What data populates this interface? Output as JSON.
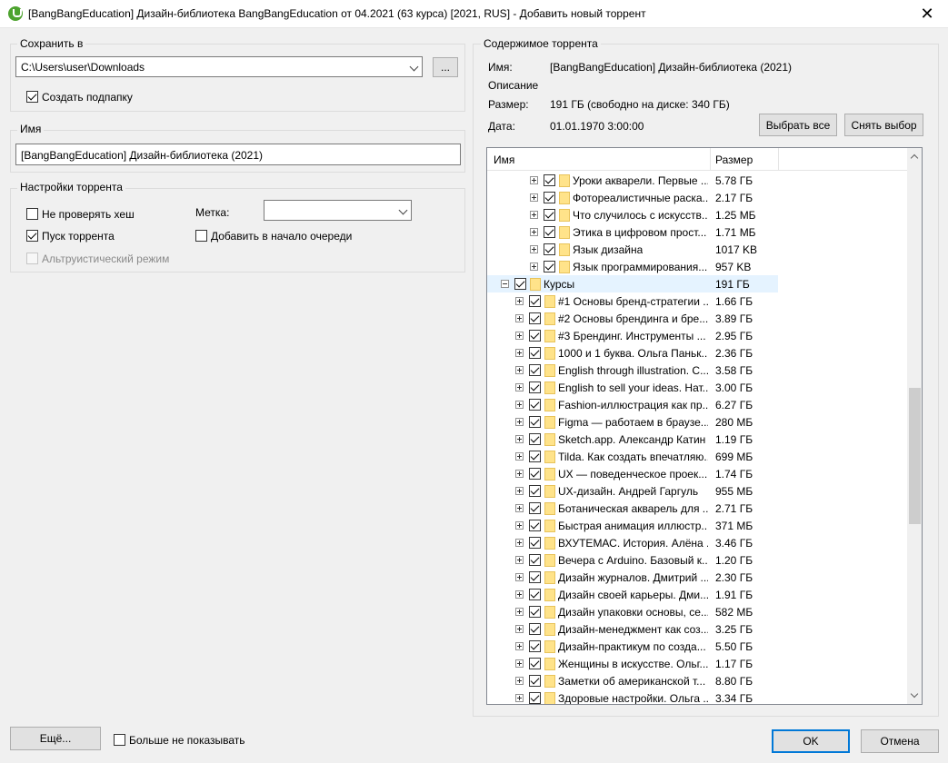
{
  "window": {
    "title": "[BangBangEducation] Дизайн-библиотека BangBangEducation от 04.2021 (63 курса) [2021, RUS] - Добавить новый торрент",
    "close_symbol": "✕"
  },
  "save_to": {
    "group_label": "Сохранить в",
    "path": "C:\\Users\\user\\Downloads",
    "browse_label": "...",
    "create_subfolder_label": "Создать подпапку",
    "create_subfolder_checked": true
  },
  "name_group": {
    "group_label": "Имя",
    "value": "[BangBangEducation] Дизайн-библиотека (2021)"
  },
  "torrent_settings": {
    "group_label": "Настройки торрента",
    "skip_hash_label": "Не проверять хеш",
    "skip_hash_checked": false,
    "start_torrent_label": "Пуск торрента",
    "start_torrent_checked": true,
    "altruistic_label": "Альтруистический режим",
    "altruistic_checked": false,
    "label_label": "Метка:",
    "label_value": "",
    "add_to_top_label": "Добавить в начало очереди",
    "add_to_top_checked": false
  },
  "contents": {
    "group_label": "Содержимое торрента",
    "name_label": "Имя:",
    "name_value": "[BangBangEducation] Дизайн-библиотека (2021)",
    "description_label": "Описание",
    "size_label": "Размер:",
    "size_value": "191 ГБ (свободно на диске: 340 ГБ)",
    "date_label": "Дата:",
    "date_value": "01.01.1970 3:00:00",
    "select_all_label": "Выбрать все",
    "deselect_label": "Снять выбор",
    "col_name": "Имя",
    "col_size": "Размер",
    "rows": [
      {
        "level": 2,
        "name": "Уроки акварели. Первые ...",
        "size": "5.78 ГБ",
        "expanded": false
      },
      {
        "level": 2,
        "name": "Фотореалистичные раска...",
        "size": "2.17 ГБ",
        "expanded": false
      },
      {
        "level": 2,
        "name": "Что случилось с искусств...",
        "size": "1.25 МБ",
        "expanded": false
      },
      {
        "level": 2,
        "name": "Этика в цифровом прост...",
        "size": "1.71 МБ",
        "expanded": false
      },
      {
        "level": 2,
        "name": "Язык дизайна",
        "size": "1017 KB",
        "expanded": false
      },
      {
        "level": 2,
        "name": "Язык программирования....",
        "size": "957 KB",
        "expanded": false
      },
      {
        "level": 0,
        "name": "Курсы",
        "size": "191 ГБ",
        "expanded": true,
        "selected": true
      },
      {
        "level": 1,
        "name": "#1 Основы бренд-стратегии ...",
        "size": "1.66 ГБ",
        "expanded": false
      },
      {
        "level": 1,
        "name": "#2 Основы брендинга и бре...",
        "size": "3.89 ГБ",
        "expanded": false
      },
      {
        "level": 1,
        "name": "#3 Брендинг. Инструменты ...",
        "size": "2.95 ГБ",
        "expanded": false
      },
      {
        "level": 1,
        "name": "1000 и 1 буква. Ольга Паньк...",
        "size": "2.36 ГБ",
        "expanded": false
      },
      {
        "level": 1,
        "name": "English through illustration. C...",
        "size": "3.58 ГБ",
        "expanded": false
      },
      {
        "level": 1,
        "name": "English to sell your ideas. Нат...",
        "size": "3.00 ГБ",
        "expanded": false
      },
      {
        "level": 1,
        "name": "Fashion-иллюстрация как пр...",
        "size": "6.27 ГБ",
        "expanded": false
      },
      {
        "level": 1,
        "name": "Figma — работаем в браузе...",
        "size": "280 МБ",
        "expanded": false
      },
      {
        "level": 1,
        "name": "Sketch.app. Александр Катин",
        "size": "1.19 ГБ",
        "expanded": false
      },
      {
        "level": 1,
        "name": "Tilda. Как создать впечатляю...",
        "size": "699 МБ",
        "expanded": false
      },
      {
        "level": 1,
        "name": "UX — поведенческое проек...",
        "size": "1.74 ГБ",
        "expanded": false
      },
      {
        "level": 1,
        "name": "UX-дизайн. Андрей Гаргуль",
        "size": "955 МБ",
        "expanded": false
      },
      {
        "level": 1,
        "name": "Ботаническая акварель для ...",
        "size": "2.71 ГБ",
        "expanded": false
      },
      {
        "level": 1,
        "name": "Быстрая анимация иллюстр...",
        "size": "371 МБ",
        "expanded": false
      },
      {
        "level": 1,
        "name": "ВХУТЕМАС. История. Алёна ...",
        "size": "3.46 ГБ",
        "expanded": false
      },
      {
        "level": 1,
        "name": "Вечера с Arduino. Базовый к...",
        "size": "1.20 ГБ",
        "expanded": false
      },
      {
        "level": 1,
        "name": "Дизайн журналов. Дмитрий ...",
        "size": "2.30 ГБ",
        "expanded": false
      },
      {
        "level": 1,
        "name": "Дизайн своей карьеры. Дми...",
        "size": "1.91 ГБ",
        "expanded": false
      },
      {
        "level": 1,
        "name": "Дизайн упаковки основы, се...",
        "size": "582 МБ",
        "expanded": false
      },
      {
        "level": 1,
        "name": "Дизайн-менеджмент как соз...",
        "size": "3.25 ГБ",
        "expanded": false
      },
      {
        "level": 1,
        "name": "Дизайн-практикум по созда...",
        "size": "5.50 ГБ",
        "expanded": false
      },
      {
        "level": 1,
        "name": "Женщины в искусстве. Ольг...",
        "size": "1.17 ГБ",
        "expanded": false
      },
      {
        "level": 1,
        "name": "Заметки об американской т...",
        "size": "8.80 ГБ",
        "expanded": false
      },
      {
        "level": 1,
        "name": "Здоровые настройки. Ольга ...",
        "size": "3.34 ГБ",
        "expanded": false
      }
    ]
  },
  "footer": {
    "more_label": "Ещё...",
    "dont_show_label": "Больше не показывать",
    "dont_show_checked": false,
    "ok_label": "OK",
    "cancel_label": "Отмена"
  }
}
